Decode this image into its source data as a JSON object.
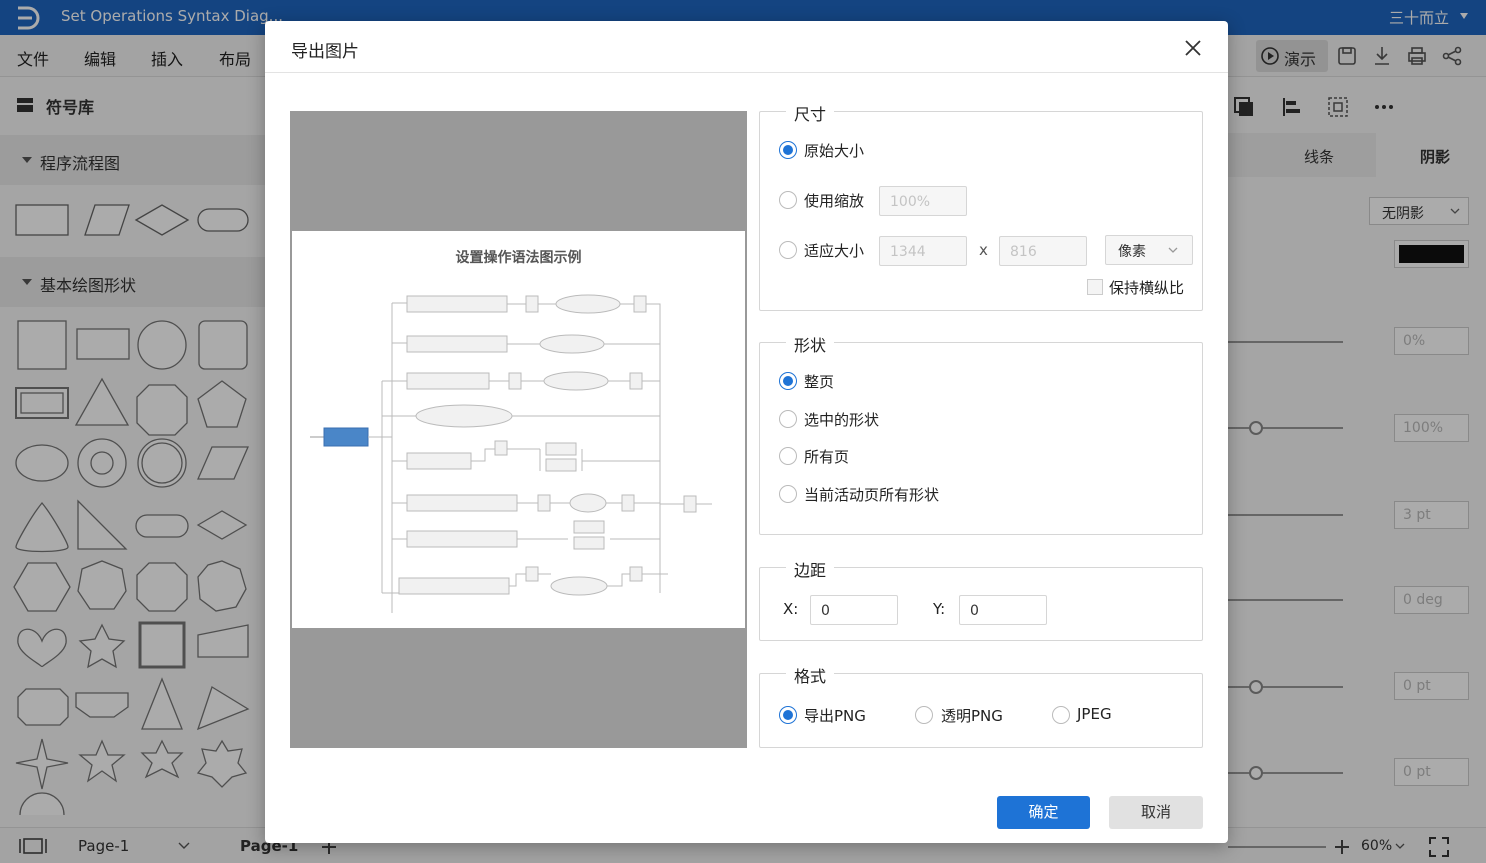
{
  "app": {
    "title": "Set Operations Syntax Diag...",
    "user": "三十而立"
  },
  "menu": [
    "文件",
    "编辑",
    "插入",
    "布局"
  ],
  "toolbar": {
    "present_label": "演示"
  },
  "left_panel": {
    "header": "符号库",
    "sections": [
      "程序流程图",
      "基本绘图形状"
    ]
  },
  "right_panel": {
    "tabs": [
      "线条",
      "阴影"
    ],
    "shadow_select": "无阴影",
    "values": [
      "0%",
      "100%",
      "3 pt",
      "0 deg",
      "0 pt",
      "0 pt"
    ]
  },
  "status": {
    "page_select": "Page-1",
    "page_tab": "Page-1",
    "zoom": "60%"
  },
  "dialog": {
    "title": "导出图片",
    "preview_title": "设置操作语法图示例",
    "size": {
      "legend": "尺寸",
      "original": "原始大小",
      "scale": "使用缩放",
      "scale_value": "100%",
      "fit": "适应大小",
      "width": "1344",
      "x": "x",
      "height": "816",
      "unit": "像素",
      "keep_ratio": "保持横纵比"
    },
    "shape": {
      "legend": "形状",
      "options": [
        "整页",
        "选中的形状",
        "所有页",
        "当前活动页所有形状"
      ]
    },
    "margin": {
      "legend": "边距",
      "x_label": "X:",
      "x_value": "0",
      "y_label": "Y:",
      "y_value": "0"
    },
    "format": {
      "legend": "格式",
      "options": [
        "导出PNG",
        "透明PNG",
        "JPEG"
      ]
    },
    "ok": "确定",
    "cancel": "取消"
  },
  "colors": {
    "brand": "#1f66c1",
    "primary_button": "#1e73d6",
    "node_highlight": "#4a86c8"
  }
}
